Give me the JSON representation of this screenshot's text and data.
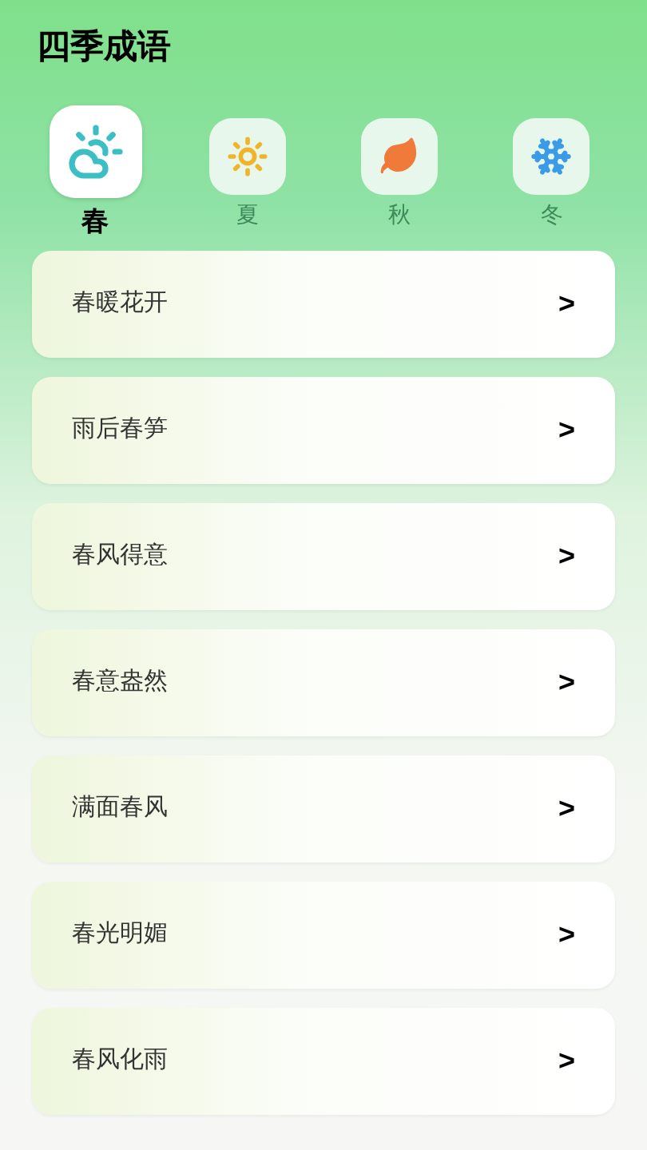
{
  "title": "四季成语",
  "tabs": [
    {
      "label": "春",
      "selected": true
    },
    {
      "label": "夏",
      "selected": false
    },
    {
      "label": "秋",
      "selected": false
    },
    {
      "label": "冬",
      "selected": false
    }
  ],
  "idioms": [
    {
      "text": "春暖花开",
      "arrow": ">"
    },
    {
      "text": "雨后春笋",
      "arrow": ">"
    },
    {
      "text": "春风得意",
      "arrow": ">"
    },
    {
      "text": "春意盎然",
      "arrow": ">"
    },
    {
      "text": "满面春风",
      "arrow": ">"
    },
    {
      "text": "春光明媚",
      "arrow": ">"
    },
    {
      "text": "春风化雨",
      "arrow": ">"
    }
  ]
}
